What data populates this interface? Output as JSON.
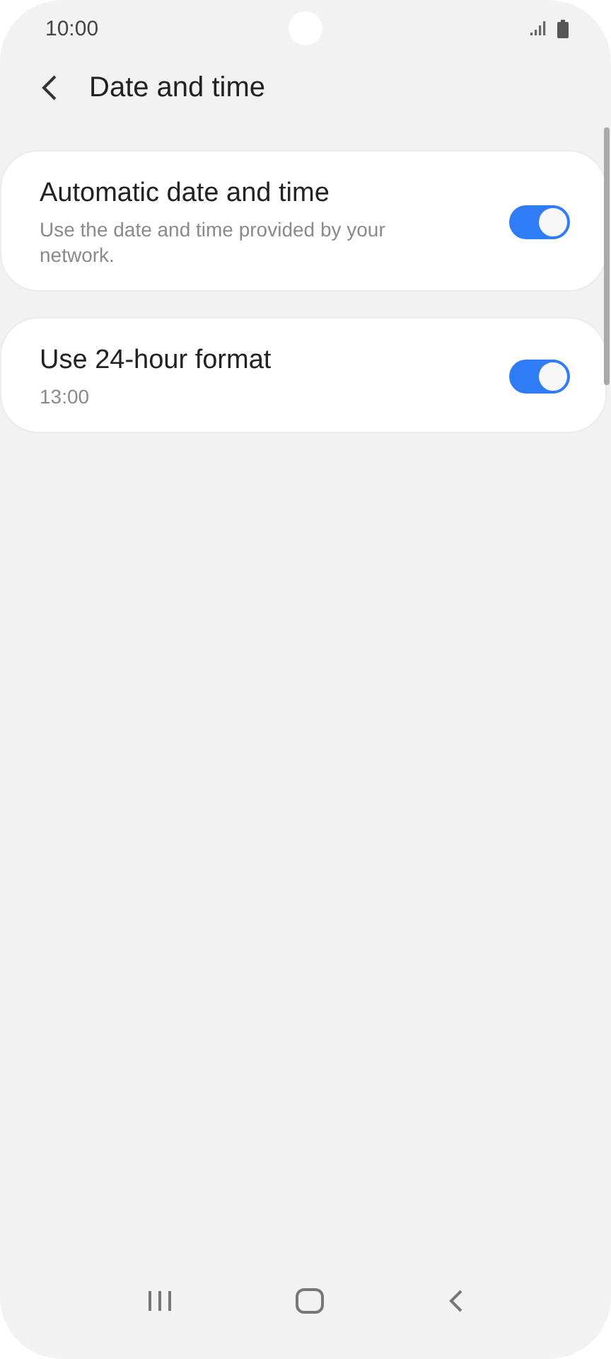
{
  "status_bar": {
    "time": "10:00"
  },
  "header": {
    "title": "Date and time"
  },
  "settings": [
    {
      "title": "Automatic date and time",
      "subtitle": "Use the date and time provided by your network.",
      "on": true
    },
    {
      "title": "Use 24-hour format",
      "subtitle": "13:00",
      "on": true
    }
  ]
}
